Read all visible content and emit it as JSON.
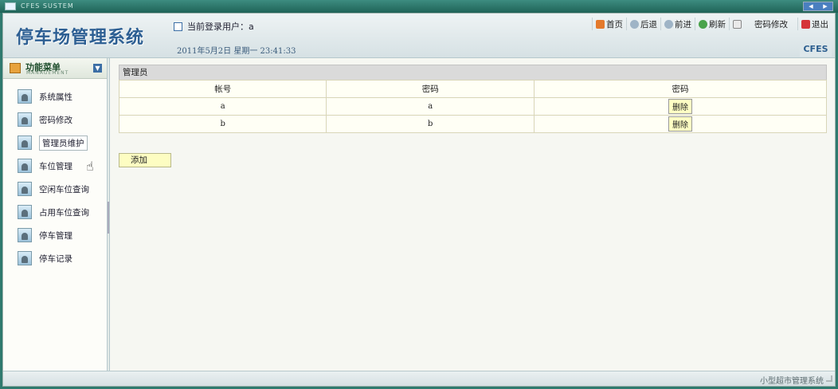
{
  "window": {
    "title": "CFES SUSTEM"
  },
  "header": {
    "logo": "停车场管理系统",
    "user_line": "当前登录用户：a",
    "date_line": "2011年5月2日  星期一  23:41:33",
    "badge": "CFES",
    "nav": [
      {
        "label": "首页",
        "icon": "home-icon"
      },
      {
        "label": "后退",
        "icon": "back-icon"
      },
      {
        "label": "前进",
        "icon": "forward-icon"
      },
      {
        "label": "刷新",
        "icon": "refresh-icon"
      },
      {
        "label": "密码修改",
        "icon": "password-icon"
      },
      {
        "label": "退出",
        "icon": "exit-icon"
      }
    ]
  },
  "sidebar": {
    "title": "功能菜单",
    "subtitle": "MANAGEMENT",
    "items": [
      {
        "label": "系统属性"
      },
      {
        "label": "密码修改"
      },
      {
        "label": "管理员维护",
        "active": true
      },
      {
        "label": "车位管理"
      },
      {
        "label": "空闲车位查询"
      },
      {
        "label": "占用车位查询"
      },
      {
        "label": "停车管理"
      },
      {
        "label": "停车记录"
      }
    ]
  },
  "main": {
    "table_title": "管理员",
    "columns": [
      "帐号",
      "密码",
      "密码"
    ],
    "rows": [
      {
        "account": "a",
        "password": "a",
        "action": "删除"
      },
      {
        "account": "b",
        "password": "b",
        "action": "删除"
      }
    ],
    "add_label": "添加"
  },
  "footer": {
    "text": "小型超市管理系统"
  }
}
